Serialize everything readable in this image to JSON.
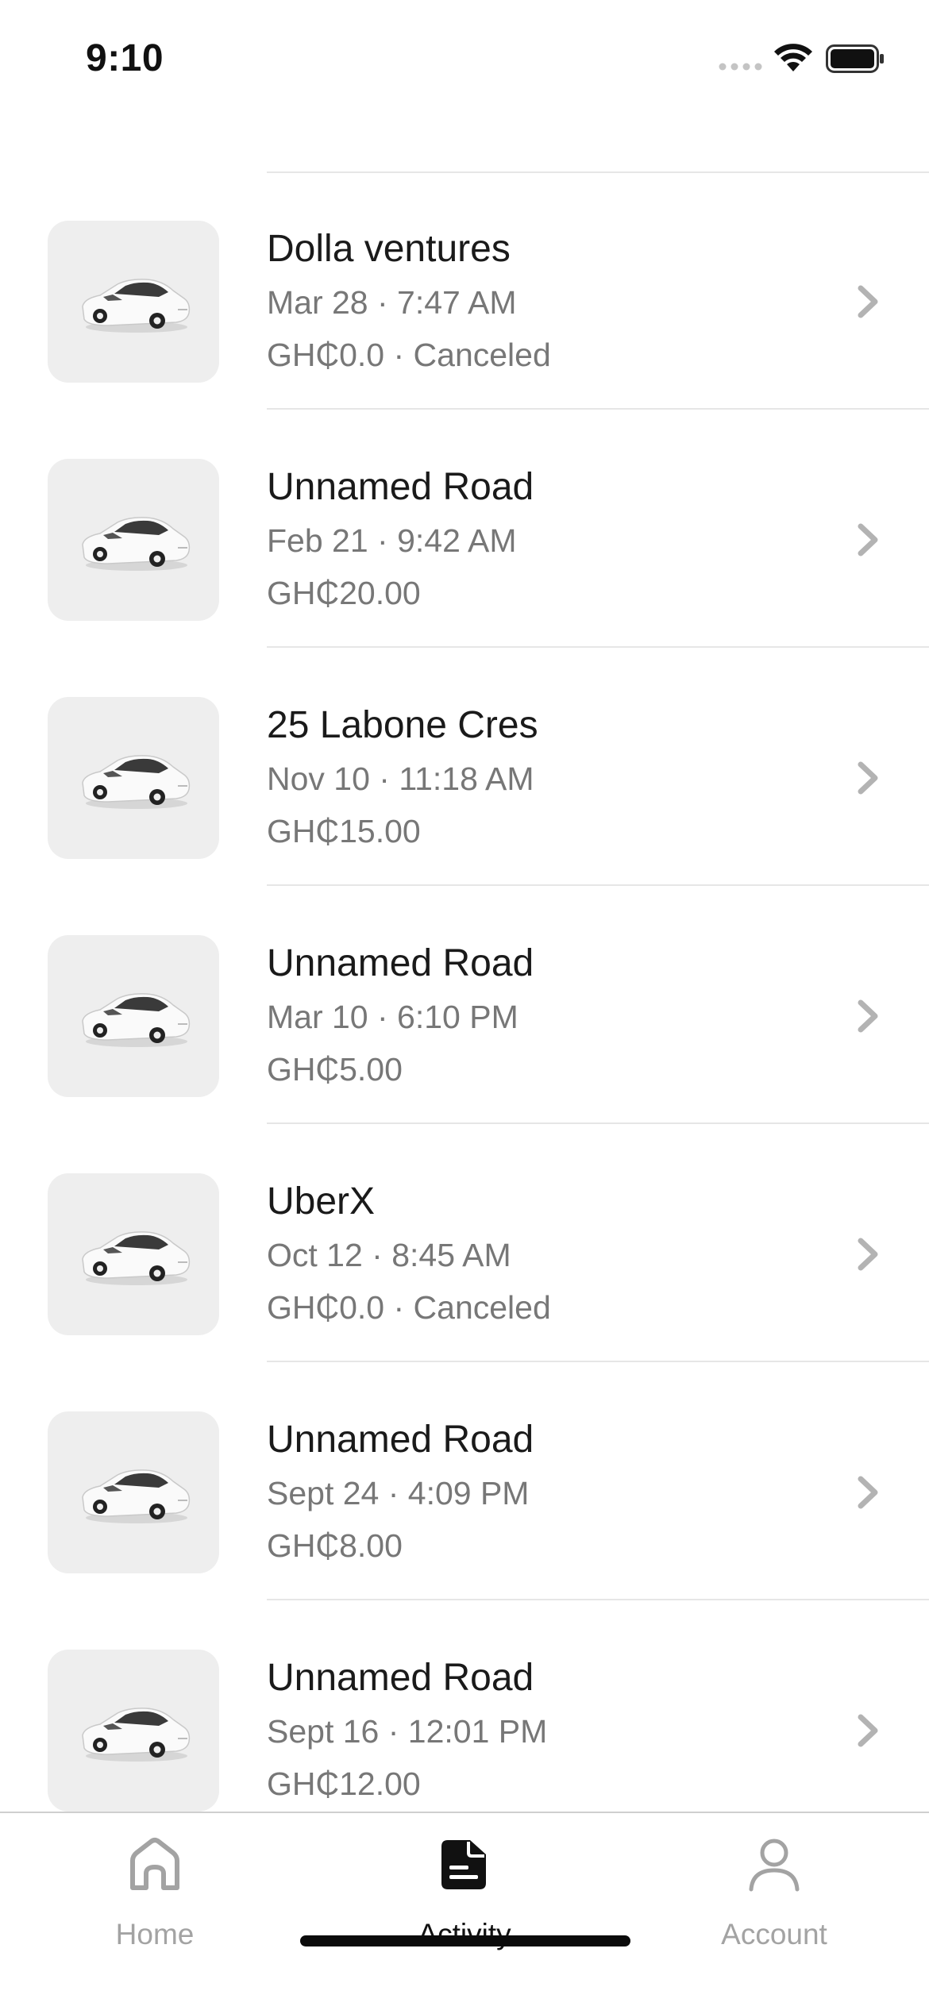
{
  "status_bar": {
    "time": "9:10"
  },
  "trips": [
    {
      "title": "Dolla ventures",
      "datetime": "Mar 28 · 7:47 AM",
      "fare": "GH₵0.0 · Canceled",
      "icon": "car-icon"
    },
    {
      "title": "Unnamed Road",
      "datetime": "Feb 21 · 9:42 AM",
      "fare": "GH₵20.00",
      "icon": "car-icon"
    },
    {
      "title": "25 Labone Cres",
      "datetime": "Nov 10 · 11:18 AM",
      "fare": "GH₵15.00",
      "icon": "car-icon"
    },
    {
      "title": "Unnamed Road",
      "datetime": "Mar 10 · 6:10 PM",
      "fare": "GH₵5.00",
      "icon": "car-icon"
    },
    {
      "title": "UberX",
      "datetime": "Oct 12 · 8:45 AM",
      "fare": "GH₵0.0 · Canceled",
      "icon": "car-icon"
    },
    {
      "title": "Unnamed Road",
      "datetime": "Sept 24 · 4:09 PM",
      "fare": "GH₵8.00",
      "icon": "car-icon"
    },
    {
      "title": "Unnamed Road",
      "datetime": "Sept 16 · 12:01 PM",
      "fare": "GH₵12.00",
      "icon": "car-icon"
    }
  ],
  "tab_bar": {
    "tabs": [
      {
        "label": "Home",
        "icon": "home-icon",
        "active": false
      },
      {
        "label": "Activity",
        "icon": "activity-icon",
        "active": true
      },
      {
        "label": "Account",
        "icon": "account-icon",
        "active": false
      }
    ]
  },
  "colors": {
    "thumb_bg": "#eeeeee",
    "secondary_text": "#777777",
    "inactive_tab": "#a3a3a3",
    "active_tab": "#111111"
  }
}
